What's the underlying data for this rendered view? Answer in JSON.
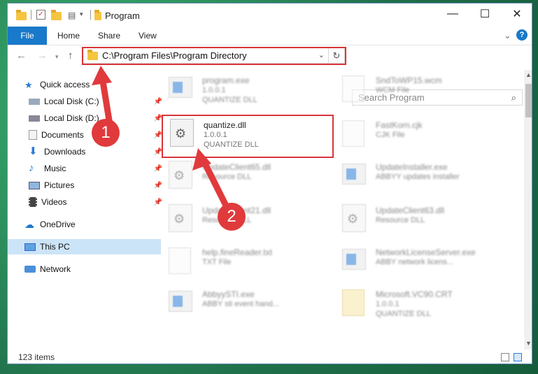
{
  "window": {
    "title": "Program"
  },
  "ribbon": {
    "file": "File",
    "tabs": [
      "Home",
      "Share",
      "View"
    ]
  },
  "nav": {
    "address": "C:\\Program Files\\Program Directory",
    "search_placeholder": "Search Program"
  },
  "sidebar": {
    "quick_access": "Quick access",
    "items": [
      {
        "label": "Local Disk (C:)"
      },
      {
        "label": "Local Disk (D:)"
      },
      {
        "label": "Documents"
      },
      {
        "label": "Downloads"
      },
      {
        "label": "Music"
      },
      {
        "label": "Pictures"
      },
      {
        "label": "Videos"
      }
    ],
    "onedrive": "OneDrive",
    "this_pc": "This PC",
    "network": "Network"
  },
  "files": [
    {
      "name": "program.exe",
      "line2": "1.0.0.1",
      "line3": "QUANTIZE DLL"
    },
    {
      "name": "SndToWP15.wcm",
      "line2": "WCM File",
      "line3": ""
    },
    {
      "name": "quantize.dll",
      "line2": "1.0.0.1",
      "line3": "QUANTIZE DLL"
    },
    {
      "name": "FastKorn.cjk",
      "line2": "CJK File",
      "line3": ""
    },
    {
      "name": "UpdateClient65.dll",
      "line2": "Resource DLL",
      "line3": ""
    },
    {
      "name": "UpdateInstaller.exe",
      "line2": "ABBYY updates installer",
      "line3": ""
    },
    {
      "name": "UpdateClient21.dll",
      "line2": "Resource DLL",
      "line3": ""
    },
    {
      "name": "UpdateClient63.dll",
      "line2": "Resource DLL",
      "line3": ""
    },
    {
      "name": "help.fineReader.txt",
      "line2": "TXT File",
      "line3": ""
    },
    {
      "name": "NetworkLicenseServer.exe",
      "line2": "ABBY network licens...",
      "line3": ""
    },
    {
      "name": "AbbyySTI.exe",
      "line2": "ABBY sti event hand...",
      "line3": ""
    },
    {
      "name": "Microsoft.VC90.CRT",
      "line2": "1.0.0.1",
      "line3": "QUANTIZE DLL"
    }
  ],
  "status": {
    "count": "123 items"
  },
  "annotations": {
    "step1": "1",
    "step2": "2",
    "color": "#e03a3c"
  }
}
